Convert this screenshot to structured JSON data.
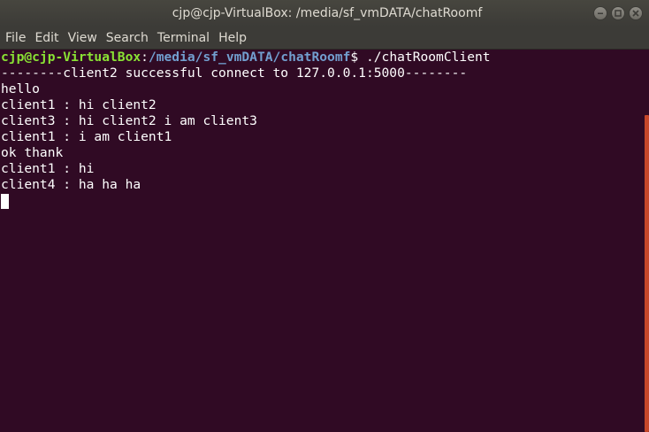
{
  "window": {
    "title": "cjp@cjp-VirtualBox: /media/sf_vmDATA/chatRoomf",
    "buttons": [
      "minimize",
      "maximize",
      "close"
    ]
  },
  "menubar": {
    "items": [
      {
        "label": "File"
      },
      {
        "label": "Edit"
      },
      {
        "label": "View"
      },
      {
        "label": "Search"
      },
      {
        "label": "Terminal"
      },
      {
        "label": "Help"
      }
    ]
  },
  "terminal": {
    "prompt": {
      "user_host": "cjp@cjp-VirtualBox",
      "separator": ":",
      "path": "/media/sf_vmDATA/chatRoomf",
      "symbol": "$ ",
      "command": "./chatRoomClient"
    },
    "output": [
      "--------client2 successful connect to 127.0.0.1:5000--------",
      "hello",
      "client1 : hi client2",
      "client3 : hi client2 i am client3",
      "client1 : i am client1",
      "ok thank",
      "client1 : hi",
      "client4 : ha ha ha"
    ]
  },
  "colors": {
    "background": "#300a24",
    "prompt_user": "#8ae234",
    "prompt_path": "#729fcf",
    "scrollbar": "#e0522c",
    "titlebar": "#3c3b37"
  }
}
